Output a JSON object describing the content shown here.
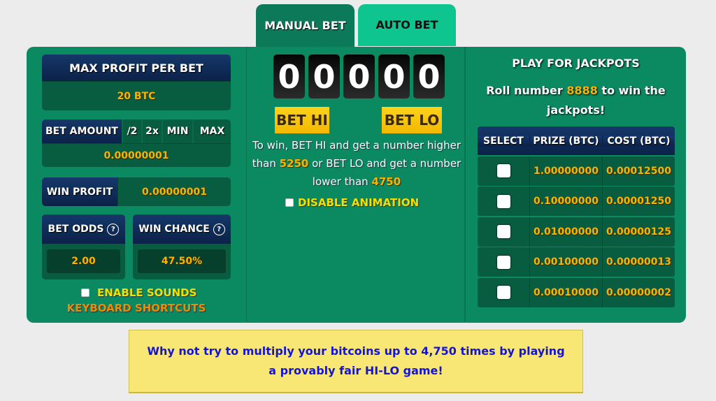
{
  "tabs": [
    {
      "label": "MANUAL BET",
      "active": true
    },
    {
      "label": "AUTO BET",
      "active": false
    }
  ],
  "left": {
    "max_profit": {
      "label": "MAX PROFIT PER BET",
      "value": "20 BTC"
    },
    "bet_amount": {
      "label": "BET AMOUNT",
      "buttons": [
        "/2",
        "2x",
        "MIN",
        "MAX"
      ],
      "value": "0.00000001"
    },
    "win_profit": {
      "label": "WIN PROFIT",
      "value": "0.00000001"
    },
    "bet_odds": {
      "label": "BET ODDS",
      "help": "?",
      "value": "2.00"
    },
    "win_chance": {
      "label": "WIN CHANCE",
      "help": "?",
      "value": "47.50%"
    },
    "enable_sounds": {
      "label": "ENABLE SOUNDS",
      "checked": false
    },
    "keyboard_shortcuts": "KEYBOARD SHORTCUTS"
  },
  "middle": {
    "digits": [
      "0",
      "0",
      "0",
      "0",
      "0"
    ],
    "bet_hi": "BET HI",
    "bet_lo": "BET LO",
    "rules": {
      "part1": "To win, BET HI and get a number higher than ",
      "hi_number": "5250",
      "part2": " or BET LO and get a number lower than ",
      "lo_number": "4750"
    },
    "disable_animation": {
      "label": "DISABLE ANIMATION",
      "checked": false
    }
  },
  "jackpots": {
    "title": "PLAY FOR JACKPOTS",
    "desc_part1": "Roll number ",
    "number": "8888",
    "desc_part2": " to win the jackpots!",
    "headers": [
      "SELECT",
      "PRIZE (BTC)",
      "COST (BTC)"
    ],
    "rows": [
      {
        "prize": "1.00000000",
        "cost": "0.00012500",
        "selected": false
      },
      {
        "prize": "0.10000000",
        "cost": "0.00001250",
        "selected": false
      },
      {
        "prize": "0.01000000",
        "cost": "0.00000125",
        "selected": false
      },
      {
        "prize": "0.00100000",
        "cost": "0.00000013",
        "selected": false
      },
      {
        "prize": "0.00010000",
        "cost": "0.00000002",
        "selected": false
      }
    ]
  },
  "promo": "Why not try to multiply your bitcoins up to 4,750 times by playing a provably fair HI-LO game!",
  "colors": {
    "panel_green": "#0b8a62",
    "tab_active": "#0c7a58",
    "tab_inactive": "#0ec58f",
    "navy": "#0f2a55",
    "gold_text": "#f7b500",
    "yellow_text": "#f2e000",
    "orange_text": "#f08a00",
    "bet_button": "#f2b800",
    "promo_bg": "#f8e774",
    "promo_text": "#1414d8"
  }
}
